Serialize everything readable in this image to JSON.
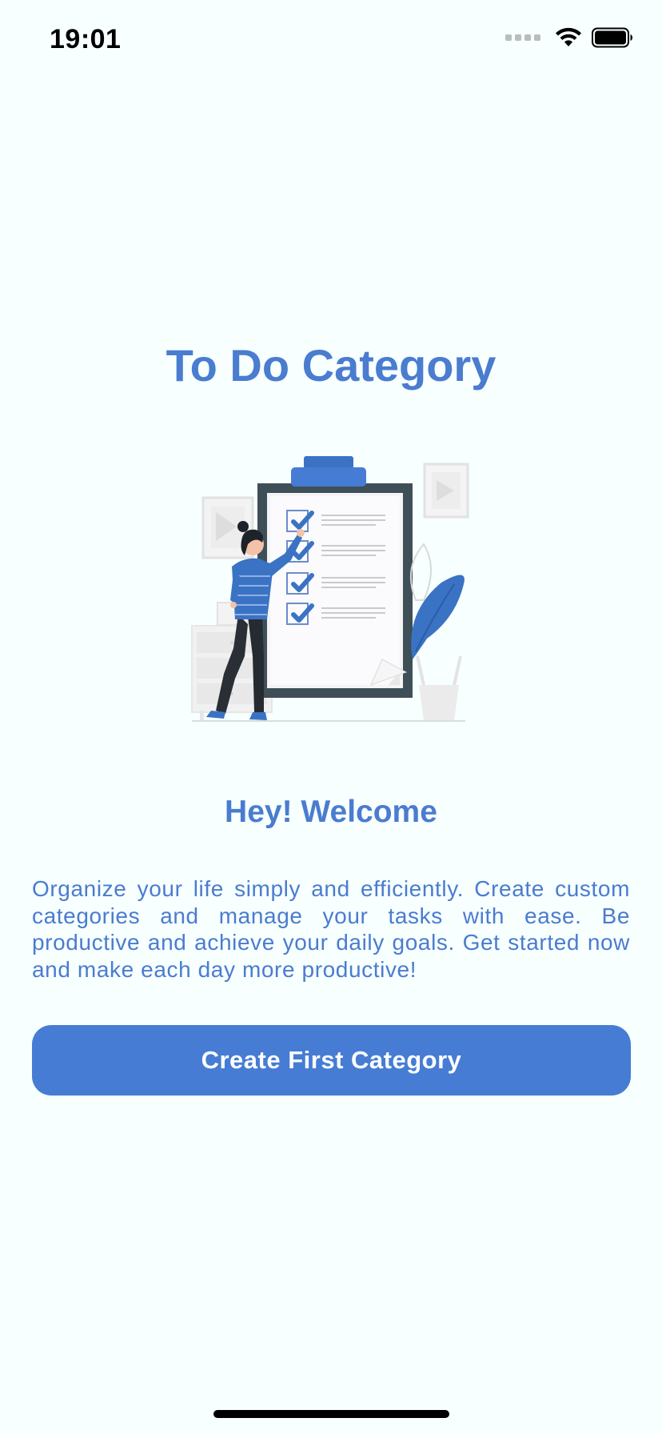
{
  "status_bar": {
    "time": "19:01"
  },
  "screen": {
    "title": "To Do Category",
    "welcome": "Hey! Welcome",
    "description": "Organize your life simply and efficiently. Create custom categories and manage your tasks with ease. Be productive and achieve your daily goals. Get started now and make each day more productive!",
    "cta_label": "Create First Category"
  },
  "theme": {
    "background": "#F7FFFF",
    "accent": "#467CD3",
    "text_accent": "#4A7CCF"
  },
  "icons": {
    "signal": "cellular-signal-icon",
    "wifi": "wifi-icon",
    "battery": "battery-icon"
  }
}
